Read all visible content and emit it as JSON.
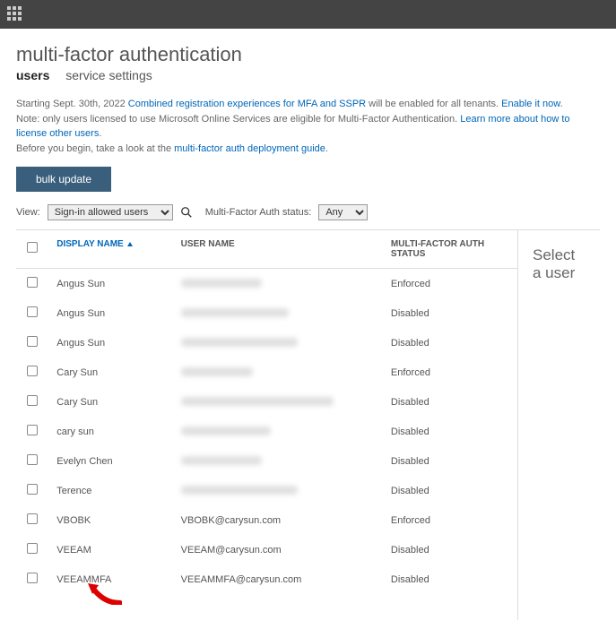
{
  "header": {
    "title": "multi-factor authentication"
  },
  "tabs": {
    "users": "users",
    "settings": "service settings"
  },
  "notice": {
    "line1_a": "Starting Sept. 30th, 2022 ",
    "line1_link": "Combined registration experiences for MFA and SSPR",
    "line1_b": " will be enabled for all tenants. ",
    "line1_link2": "Enable it now",
    "line1_c": ".",
    "line2_a": "Note: only users licensed to use Microsoft Online Services are eligible for Multi-Factor Authentication. ",
    "line2_link": "Learn more about how to license other users",
    "line2_b": ".",
    "line3_a": "Before you begin, take a look at the ",
    "line3_link": "multi-factor auth deployment guide",
    "line3_b": "."
  },
  "buttons": {
    "bulk_update": "bulk update"
  },
  "filters": {
    "view_label": "View:",
    "view_value": "Sign-in allowed users",
    "status_label": "Multi-Factor Auth status:",
    "status_value": "Any"
  },
  "columns": {
    "display_name": "DISPLAY NAME",
    "user_name": "USER NAME",
    "mfa_status": "MULTI-FACTOR AUTH STATUS"
  },
  "side": {
    "select_user": "Select a user"
  },
  "rows": [
    {
      "name": "Angus Sun",
      "user_blurred": true,
      "user": "",
      "status": "Enforced"
    },
    {
      "name": "Angus Sun",
      "user_blurred": true,
      "user": "",
      "status": "Disabled"
    },
    {
      "name": "Angus Sun",
      "user_blurred": true,
      "user": "",
      "status": "Disabled"
    },
    {
      "name": "Cary Sun",
      "user_blurred": true,
      "user": "",
      "status": "Enforced"
    },
    {
      "name": "Cary Sun",
      "user_blurred": true,
      "user": "",
      "status": "Disabled"
    },
    {
      "name": "cary sun",
      "user_blurred": true,
      "user": "",
      "status": "Disabled"
    },
    {
      "name": "Evelyn Chen",
      "user_blurred": true,
      "user": "",
      "status": "Disabled"
    },
    {
      "name": "Terence",
      "user_blurred": true,
      "user": "",
      "status": "Disabled"
    },
    {
      "name": "VBOBK",
      "user_blurred": false,
      "user": "VBOBK@carysun.com",
      "status": "Enforced"
    },
    {
      "name": "VEEAM",
      "user_blurred": false,
      "user": "VEEAM@carysun.com",
      "status": "Disabled"
    },
    {
      "name": "VEEAMMFA",
      "user_blurred": false,
      "user": "VEEAMMFA@carysun.com",
      "status": "Disabled"
    }
  ]
}
